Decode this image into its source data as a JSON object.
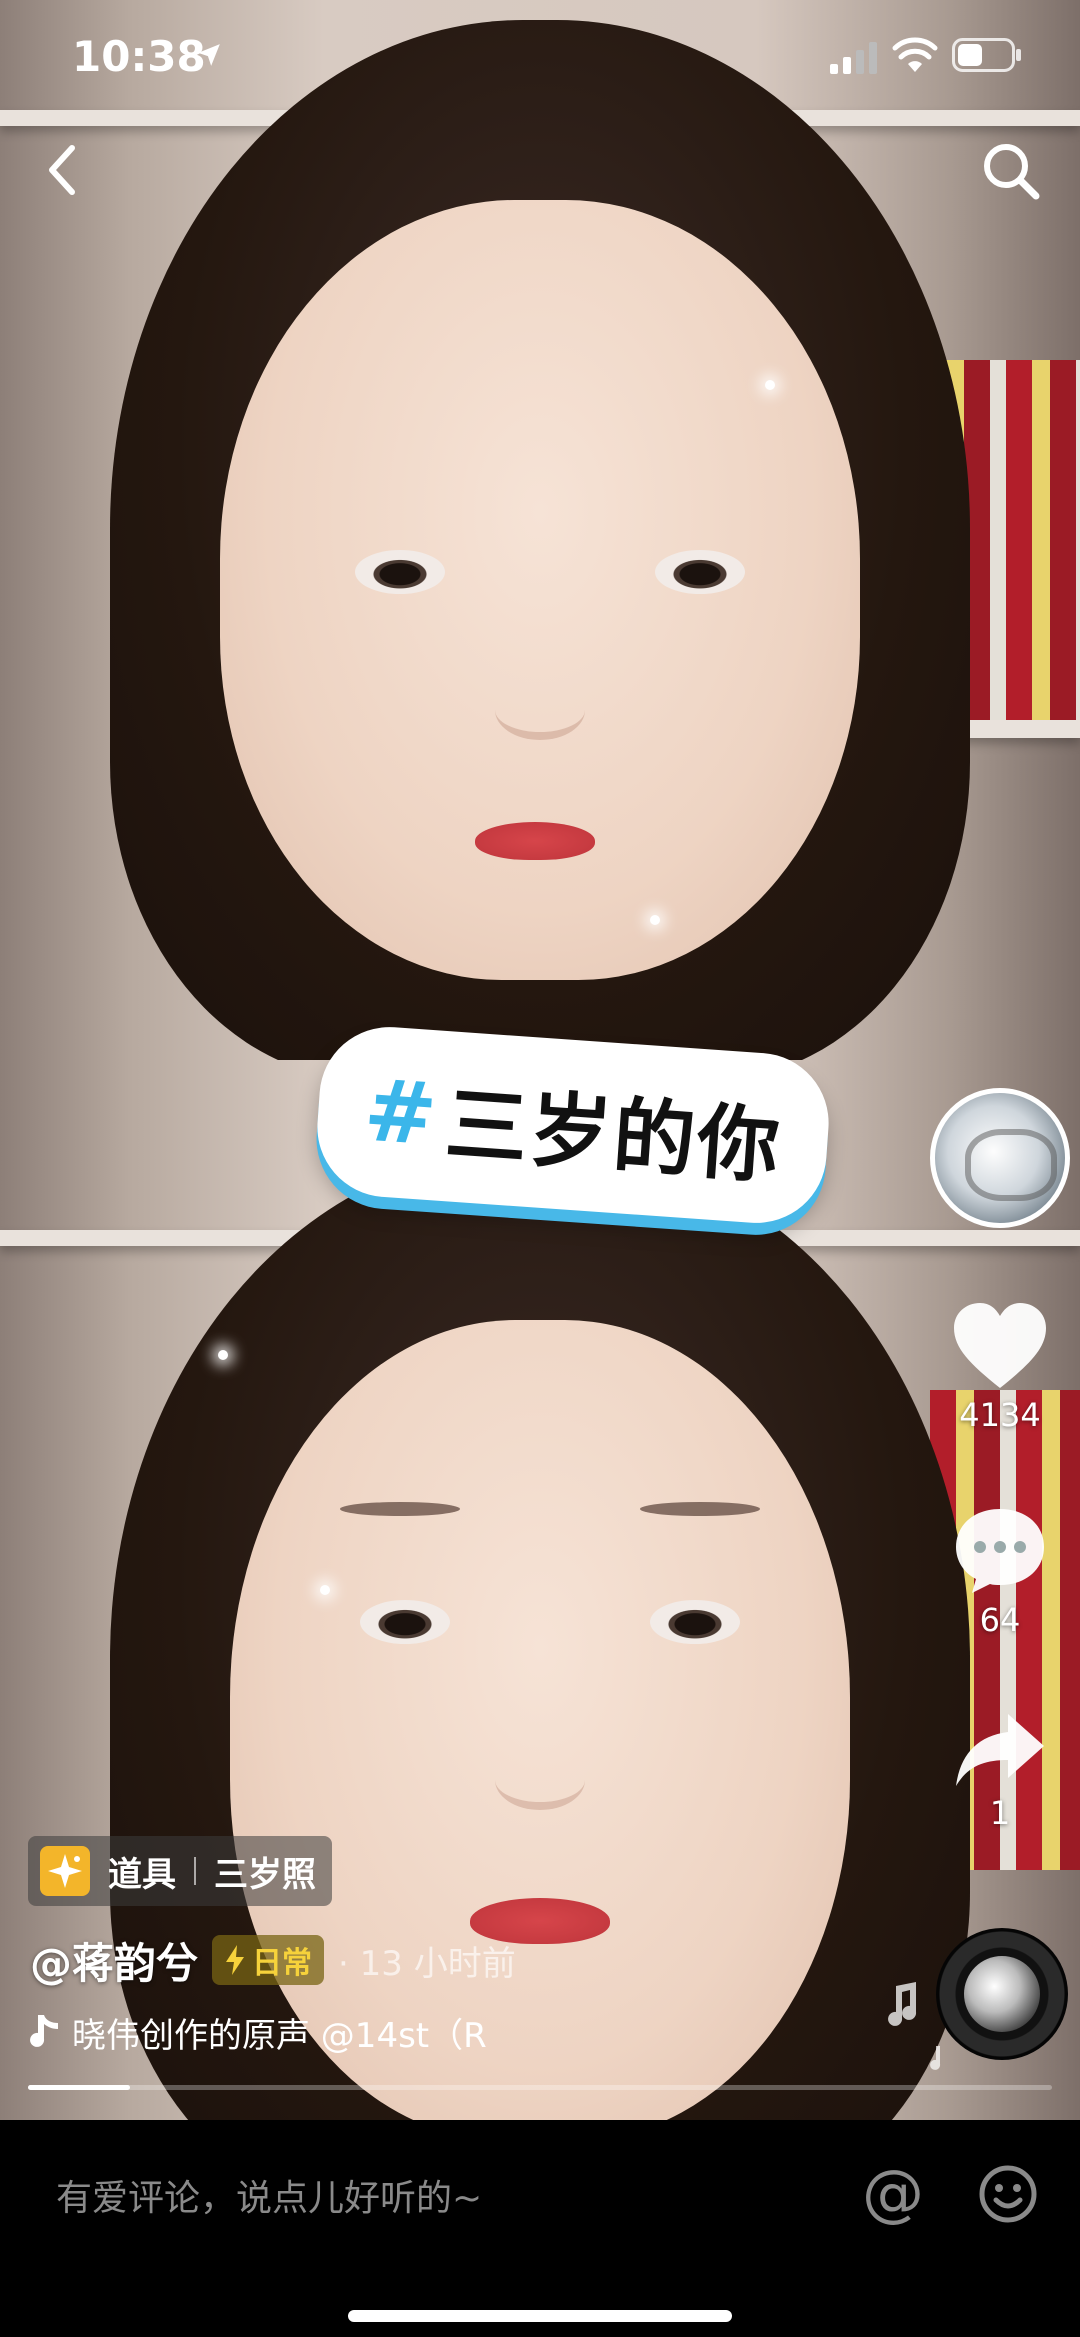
{
  "status_bar": {
    "time": "10:38"
  },
  "hashtag": {
    "symbol": "#",
    "text": "三岁的你"
  },
  "rail": {
    "likes": "4134",
    "comments": "64",
    "shares": "1"
  },
  "prop": {
    "label": "道具",
    "name": "三岁照"
  },
  "author": {
    "handle": "@蒋韵兮",
    "badge": "日常",
    "time_ago": "· 13 小时前"
  },
  "music": {
    "text": "晓伟创作的原声     @14st（R"
  },
  "progress": {
    "fraction": 0.1
  },
  "comment_bar": {
    "placeholder": "有爱评论，说点儿好听的~",
    "at_symbol": "@"
  },
  "colors": {
    "hashtag_accent": "#3bb6ea",
    "badge_text": "#f6d23b",
    "prop_icon_bg": "#f3b52a"
  },
  "icons": [
    "location-arrow-icon",
    "signal-icon",
    "wifi-icon",
    "battery-icon",
    "back-arrow-icon",
    "search-icon",
    "heart-icon",
    "comment-icon",
    "share-icon",
    "music-note-icon",
    "emoji-icon",
    "lightning-icon",
    "sparkle-icon"
  ]
}
